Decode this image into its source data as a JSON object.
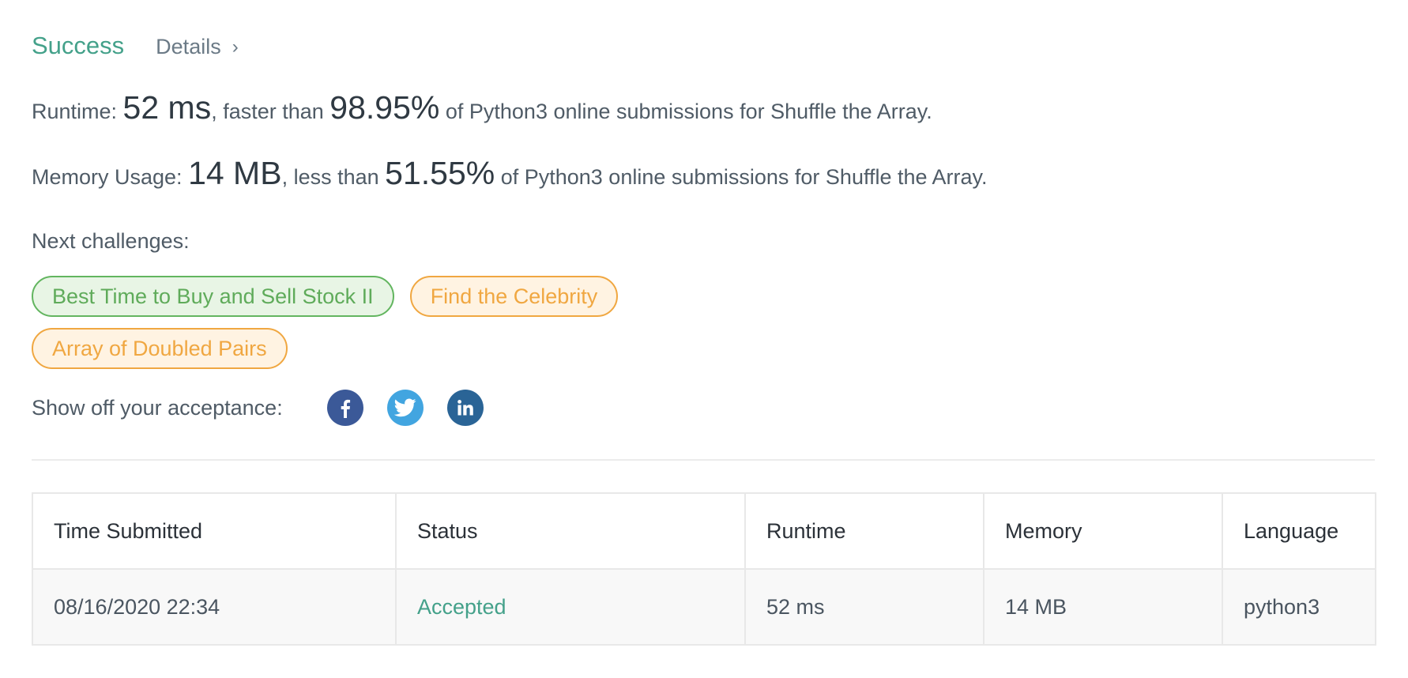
{
  "result": {
    "status": "Success",
    "details_label": "Details",
    "details_chevron": "›"
  },
  "runtime": {
    "label": "Runtime: ",
    "value": "52 ms",
    "comparison": ", faster than ",
    "percent": "98.95%",
    "suffix": " of Python3 online submissions for Shuffle the Array."
  },
  "memory": {
    "label": "Memory Usage: ",
    "value": "14 MB",
    "comparison": ", less than ",
    "percent": "51.55%",
    "suffix": " of Python3 online submissions for Shuffle the Array."
  },
  "next_challenges": {
    "label": "Next challenges:",
    "items": [
      {
        "title": "Best Time to Buy and Sell Stock II",
        "difficulty": "easy"
      },
      {
        "title": "Find the Celebrity",
        "difficulty": "medium"
      },
      {
        "title": "Array of Doubled Pairs",
        "difficulty": "medium"
      }
    ]
  },
  "share": {
    "label": "Show off your acceptance:",
    "icons": [
      "facebook-icon",
      "twitter-icon",
      "linkedin-icon"
    ]
  },
  "colors": {
    "success": "#44a18a",
    "easy": "#62b55f",
    "medium": "#f0a741",
    "facebook": "#3b5998",
    "twitter": "#42a5e0",
    "linkedin": "#2a6496"
  },
  "submissions": {
    "headers": [
      "Time Submitted",
      "Status",
      "Runtime",
      "Memory",
      "Language"
    ],
    "rows": [
      {
        "time": "08/16/2020 22:34",
        "status": "Accepted",
        "runtime": "52 ms",
        "memory": "14 MB",
        "language": "python3"
      }
    ]
  }
}
